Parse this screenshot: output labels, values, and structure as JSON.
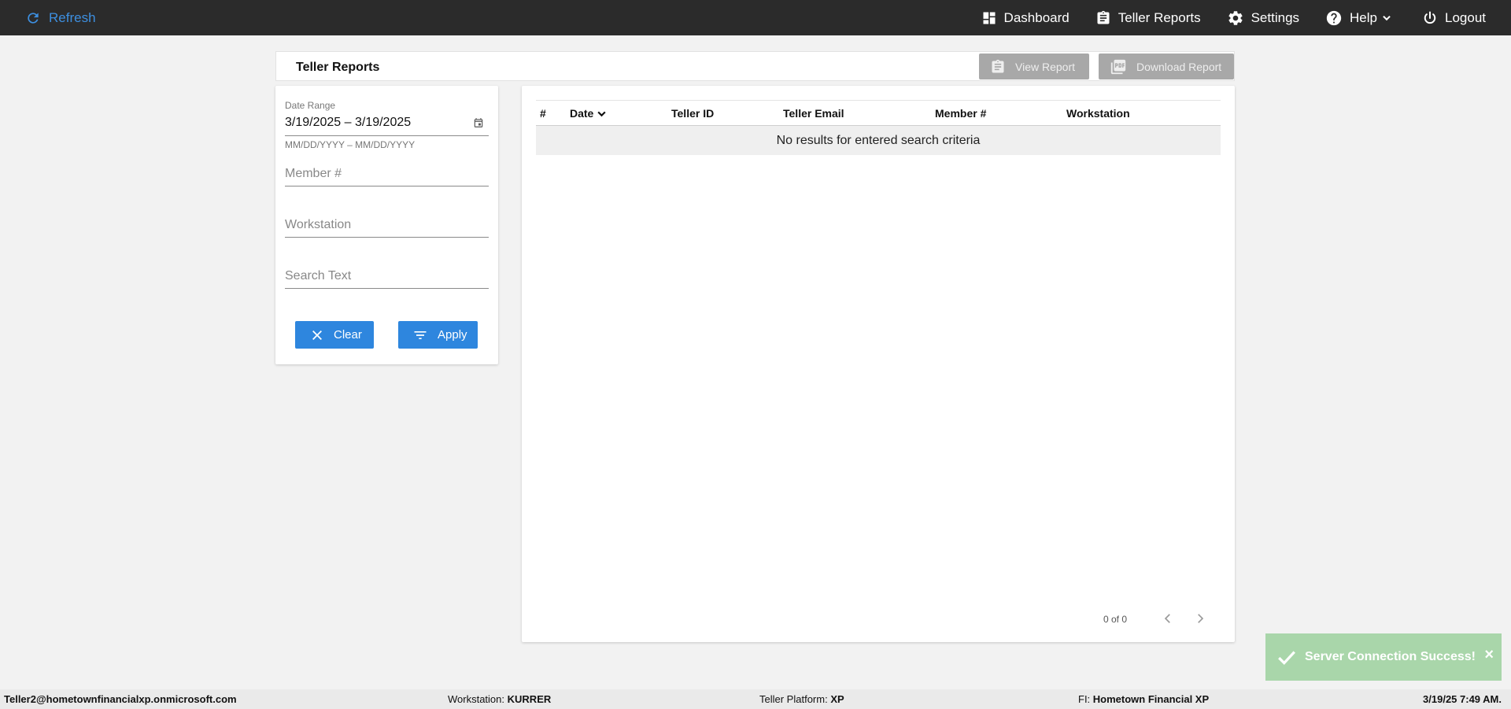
{
  "topbar": {
    "refresh_label": "Refresh",
    "nav": {
      "dashboard": "Dashboard",
      "teller_reports": "Teller Reports",
      "settings": "Settings",
      "help": "Help",
      "logout": "Logout"
    }
  },
  "page": {
    "title": "Teller Reports",
    "view_report_label": "View Report",
    "download_report_label": "Download Report"
  },
  "filters": {
    "date_range_label": "Date Range",
    "date_range_value": "3/19/2025 – 3/19/2025",
    "date_range_hint": "MM/DD/YYYY – MM/DD/YYYY",
    "member_placeholder": "Member #",
    "workstation_placeholder": "Workstation",
    "search_placeholder": "Search Text",
    "clear_label": "Clear",
    "apply_label": "Apply"
  },
  "table": {
    "columns": [
      "#",
      "Date",
      "Teller ID",
      "Teller Email",
      "Member #",
      "Workstation"
    ],
    "sort_column": "Date",
    "empty_message": "No results for entered search criteria",
    "pagination": "0 of 0"
  },
  "toast": {
    "message": "Server Connection Success!",
    "close": "×"
  },
  "footer": {
    "user": "Teller2@hometownfinancialxp.onmicrosoft.com",
    "workstation_label": "Workstation:",
    "workstation_value": "KURRER",
    "platform_label": "Teller Platform:",
    "platform_value": "XP",
    "fi_label": "FI:",
    "fi_value": "Hometown Financial XP",
    "timestamp": "3/19/25 7:49 AM."
  },
  "colors": {
    "topbar": "#2b2b2b",
    "accent": "#2e86de",
    "refresh": "#3d8fe0",
    "disabled_button": "#a8a8a8",
    "toast": "#a9d6aa"
  }
}
